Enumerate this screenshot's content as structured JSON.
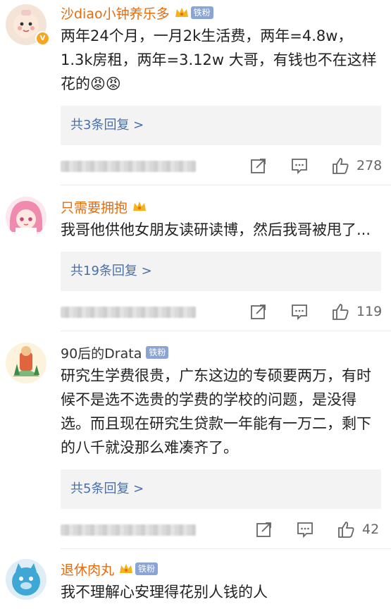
{
  "comments": [
    {
      "name": "沙diao小钟养乐多",
      "badge": "铁粉",
      "text": "两年24个月，一月2k生活费，两年=4.8w，1.3k房租，两年=3.12w 大哥，有钱也不在这样花的😡😡",
      "replies": "共3条回复 >",
      "likes": "278"
    },
    {
      "name": "只需要拥抱",
      "text": "我哥他供他女朋友读研读博，然后我哥被甩了...",
      "replies": "共19条回复 >",
      "likes": "119"
    },
    {
      "name": "90后的Drata",
      "badge": "铁粉",
      "text": "研究生学费很贵，广东这边的专硕要两万，有时候不是选不选贵的学费的学校的问题，是没得选。而且现在研究生贷款一年能有一万二，剩下的八千就没那么难凑齐了。",
      "replies": "共5条回复 >",
      "likes": "42"
    },
    {
      "name": "退休肉丸",
      "badge": "铁粉",
      "text": "我不理解心安理得花别人钱的人"
    }
  ]
}
